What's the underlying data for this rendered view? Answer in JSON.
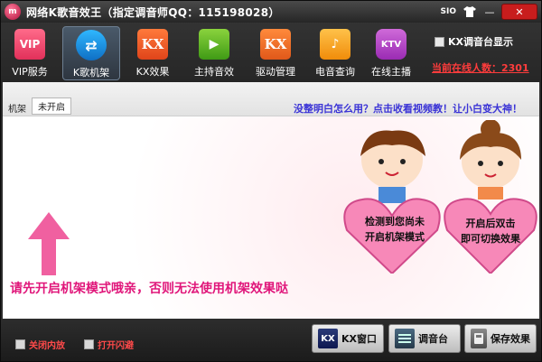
{
  "window": {
    "logo": "m",
    "title": "网络K歌音效王（指定调音师QQ：115198028）",
    "sio_label": "SIO",
    "icon_shirt": "shirt-icon",
    "icon_minimize": "minimize-icon",
    "icon_close": "close-icon",
    "minimize_glyph": "—",
    "close_glyph": "✕"
  },
  "toolbar": {
    "items": [
      {
        "label": "VIP服务",
        "icon": "crown-vip-icon",
        "glyph": "VIP",
        "active": false
      },
      {
        "label": "K歌机架",
        "icon": "karaoke-rack-icon",
        "glyph": "⇄",
        "active": true
      },
      {
        "label": "KX效果",
        "icon": "kx-effect-icon",
        "glyph": "KX",
        "active": false
      },
      {
        "label": "主持音效",
        "icon": "host-sound-icon",
        "glyph": "▶",
        "active": false
      },
      {
        "label": "驱动管理",
        "icon": "driver-kx-icon",
        "glyph": "KX",
        "active": false
      },
      {
        "label": "电音查询",
        "icon": "folder-icon",
        "glyph": "♪",
        "active": false
      },
      {
        "label": "在线主播",
        "icon": "ktv-mic-icon",
        "glyph": "KTV",
        "active": false
      }
    ],
    "show_mixer_label": "KX调音台显示",
    "online_count": "当前在线人数：2301"
  },
  "tabs": {
    "rack_label": "机架",
    "status_button": "未开启",
    "help_link": "没整明白怎么用？点击收看视频教！让小白变大神！"
  },
  "content": {
    "warning": "请先开启机架模式哦亲，否则无法使用机架效果哒",
    "boy_bubble_line1": "检测到您尚未",
    "boy_bubble_line2": "开启机架模式",
    "girl_bubble_line1": "开启后双击",
    "girl_bubble_line2": "即可切换效果"
  },
  "bottom": {
    "close_internal_label": "关闭内放",
    "open_flash_label": "打开闪避",
    "kx_window_label": "KX窗口",
    "mixer_label": "调音台",
    "save_effect_label": "保存效果",
    "kx_icon_glyph": "KX"
  },
  "colors": {
    "accent_pink": "#e0167a",
    "online_red": "#ff3c3c",
    "link_blue": "#3a33d6"
  }
}
